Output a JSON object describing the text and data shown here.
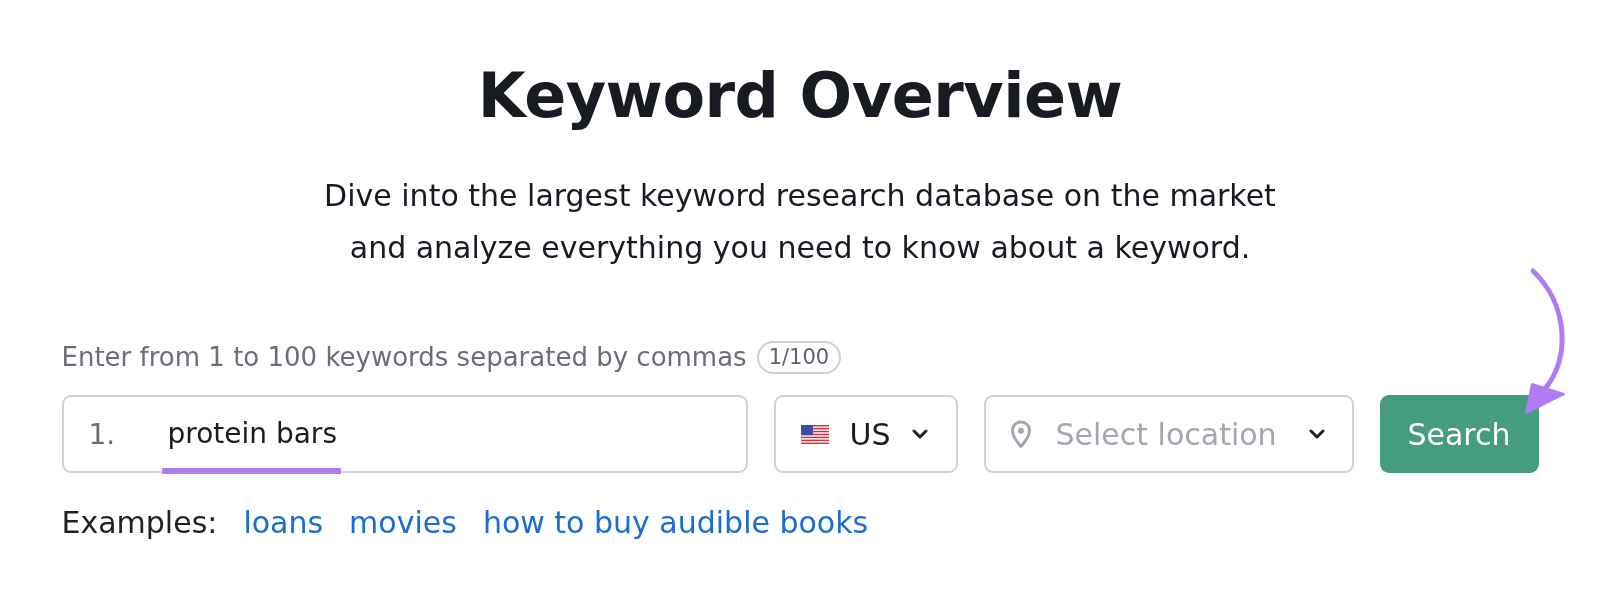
{
  "page": {
    "title": "Keyword Overview",
    "subtitle": "Dive into the largest keyword research database on the market and analyze everything you need to know about a keyword."
  },
  "keyword_form": {
    "hint": "Enter from 1 to 100 keywords separated by commas",
    "counter": "1/100",
    "keywords": [
      {
        "number": "1.",
        "value": "protein bars",
        "highlighted": true
      }
    ],
    "database_select": {
      "value": "US"
    },
    "location_select": {
      "placeholder": "Select location"
    },
    "search_button": {
      "label": "Search",
      "arrow_pointer": true
    }
  },
  "examples": {
    "label": "Examples:",
    "links": [
      "loans",
      "movies",
      "how to buy audible books"
    ]
  }
}
